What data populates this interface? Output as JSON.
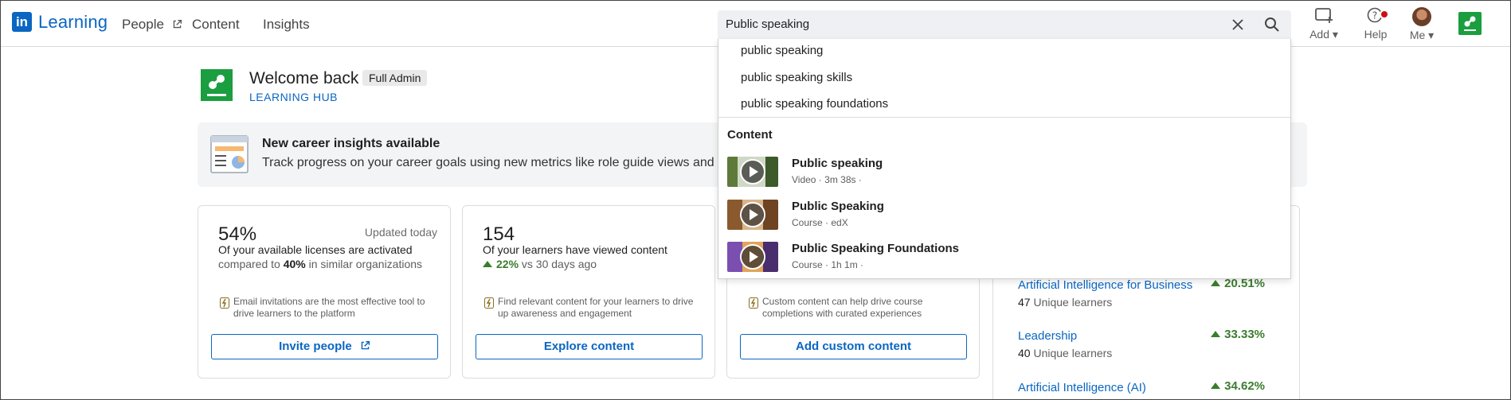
{
  "colors": {
    "brand": "#0a66c2",
    "positive": "#3a7d2c",
    "org_green": "#1a9e3f",
    "alert": "#cc1016"
  },
  "topnav": {
    "logo_mark": "in",
    "logo_text": "Learning",
    "nav": [
      {
        "label": "People",
        "icon": "external-link-icon"
      },
      {
        "label": "Content"
      },
      {
        "label": "Insights"
      }
    ],
    "search": {
      "value": "Public speaking"
    },
    "actions": [
      {
        "label": "Add",
        "icon": "add-box-icon"
      },
      {
        "label": "Help",
        "icon": "help-icon"
      },
      {
        "label": "Me",
        "icon": "avatar"
      }
    ]
  },
  "welcome": {
    "title": "Welcome back",
    "role": "Full Admin",
    "hub": "LEARNING HUB"
  },
  "banner": {
    "title": "New career insights available",
    "description": "Track progress on your career goals using new metrics like role guide views and"
  },
  "cards": [
    {
      "big": "54%",
      "updated": "Updated today",
      "line1": "Of your available licenses are activated",
      "line2_pre": "compared to ",
      "line2_bold": "40%",
      "line2_post": " in similar organizations",
      "tip": "Email invitations are the most effective tool to drive learners to the platform",
      "button": "Invite people"
    },
    {
      "big": "154",
      "line1": "Of your learners have viewed content",
      "change": "22%",
      "change_post": " vs 30 days ago",
      "tip": "Find relevant content for your learners to drive up awareness and engagement",
      "button": "Explore content"
    },
    {
      "tip": "Custom content can help drive course completions with curated experiences",
      "button": "Add custom content"
    }
  ],
  "top_content": [
    {
      "title": "Artificial Intelligence for Business",
      "pct": "20.51%",
      "count": "47",
      "count_label": " Unique learners"
    },
    {
      "title": "Leadership",
      "pct": "33.33%",
      "count": "40",
      "count_label": " Unique learners"
    },
    {
      "title": "Artificial Intelligence (AI)",
      "pct": "34.62%"
    }
  ],
  "dropdown": {
    "suggestions": [
      "public speaking",
      "public speaking skills",
      "public speaking foundations"
    ],
    "section": "Content",
    "results": [
      {
        "title": "Public speaking",
        "meta": "Video  ·  3m 38s  ·"
      },
      {
        "title": "Public Speaking",
        "meta": "Course  ·  edX"
      },
      {
        "title": "Public Speaking Foundations",
        "meta": "Course  ·  1h 1m  ·"
      }
    ]
  }
}
